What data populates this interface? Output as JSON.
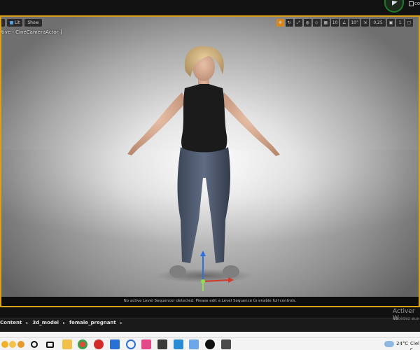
{
  "viewport": {
    "buttons": [
      "Lit",
      "Show"
    ],
    "right_toolbar": {
      "grid_snap": "10",
      "rotation_snap": "10°",
      "scale_snap": "0,25",
      "camera_speed": "1"
    },
    "label": "tive - CineCameraActor ]",
    "status_message": "No active Level Sequencer detected. Please edit a Level Sequence to enable full controls."
  },
  "title_strip": {
    "corner_label": "co"
  },
  "content_browser": {
    "breadcrumb": [
      "Content",
      "3d_model",
      "female_pregnant"
    ]
  },
  "watermark": {
    "title": "Activer W",
    "subtitle": "Accédez aux"
  },
  "taskbar": {
    "weather": {
      "temperature": "24°C",
      "condition": "Ciel c"
    }
  },
  "colors": {
    "viewport_border": "#d9a21a",
    "accent_orange": "#d7861e"
  }
}
